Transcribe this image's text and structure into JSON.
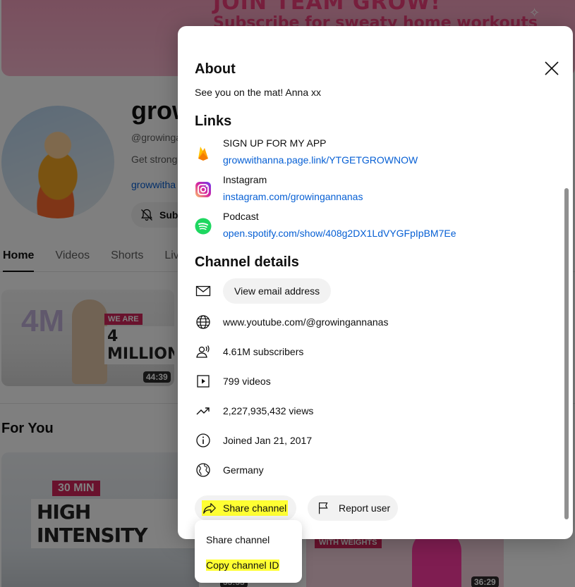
{
  "background": {
    "banner": {
      "line1": "JOIN TEAM GROW!",
      "line2": "Subscribe for sweaty home workouts"
    },
    "channel": {
      "title": "grow",
      "handle": "@growinga",
      "description": "Get strong,",
      "link": "growwitha",
      "subscribe_label": "Subs"
    },
    "tabs": [
      "Home",
      "Videos",
      "Shorts",
      "Liv"
    ],
    "featured_video": {
      "badge": "WE ARE",
      "headline": "4 MILLION",
      "numeral": "4M",
      "duration": "44:39"
    },
    "section_title": "For You",
    "videos": [
      {
        "tag": "30 MIN",
        "headline": "HIGH INTENSITY",
        "duration": "33:33"
      },
      {
        "tag": "WITH WEIGHTS",
        "duration": "36:29"
      }
    ]
  },
  "modal": {
    "about_title": "About",
    "about_text": "See you on the mat! Anna xx",
    "links_title": "Links",
    "links": [
      {
        "title": "SIGN UP FOR MY APP",
        "url": "growwithanna.page.link/YTGETGROWNOW",
        "icon": "firebase-icon"
      },
      {
        "title": "Instagram",
        "url": "instagram.com/growingannanas",
        "icon": "instagram-icon"
      },
      {
        "title": "Podcast",
        "url": "open.spotify.com/show/408g2DX1LdVYGFpIpBM7Ee",
        "icon": "spotify-icon"
      }
    ],
    "details_title": "Channel details",
    "email_button": "View email address",
    "details": {
      "url": "www.youtube.com/@growingannanas",
      "subscribers": "4.61M subscribers",
      "videos": "799 videos",
      "views": "2,227,935,432 views",
      "joined": "Joined Jan 21, 2017",
      "country": "Germany"
    },
    "share_button": "Share channel",
    "report_button": "Report user"
  },
  "dropdown": {
    "items": [
      "Share channel",
      "Copy channel ID"
    ]
  },
  "colors": {
    "link": "#065fd4",
    "highlight": "#ffff33",
    "instagram": "#d6249f",
    "spotify": "#1ed760",
    "firebase": "#ffa000"
  }
}
